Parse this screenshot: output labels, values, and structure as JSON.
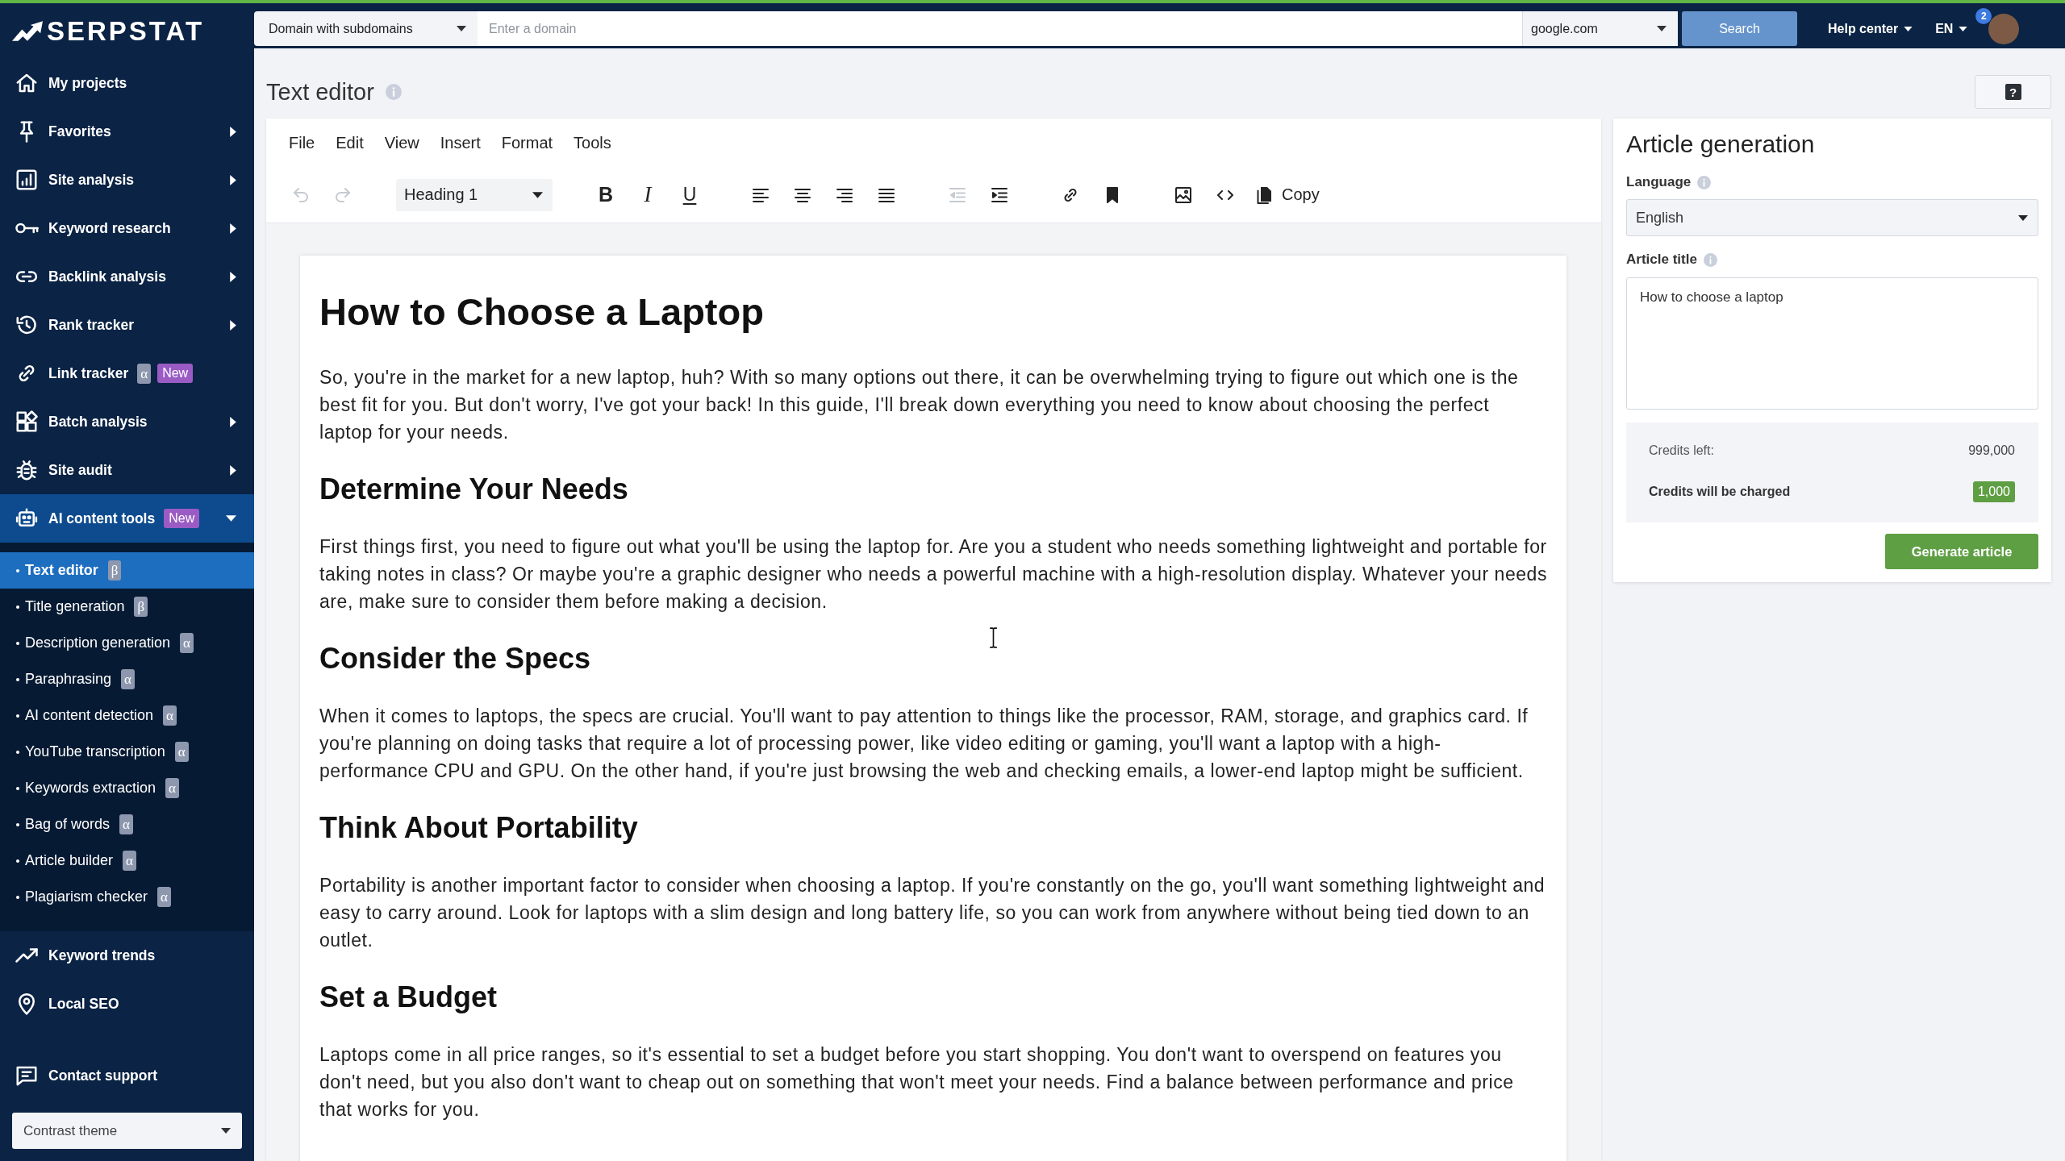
{
  "logo": {
    "text": "SERPSTAT"
  },
  "sidebar": {
    "items": [
      {
        "label": "My projects",
        "kind": "link",
        "selected": false
      },
      {
        "label": "Favorites",
        "kind": "group",
        "expanded": false,
        "selected": false
      },
      {
        "label": "Site analysis",
        "kind": "group",
        "expanded": false,
        "selected": false
      },
      {
        "label": "Keyword research",
        "kind": "group",
        "expanded": false,
        "selected": false
      },
      {
        "label": "Backlink analysis",
        "kind": "group",
        "expanded": false,
        "selected": false
      },
      {
        "label": "Rank tracker",
        "kind": "group",
        "expanded": false,
        "selected": false
      },
      {
        "label": "Link tracker",
        "kind": "link",
        "selected": false,
        "badges": [
          {
            "kind": "stage",
            "text": "α"
          },
          {
            "kind": "new",
            "text": "New"
          }
        ]
      },
      {
        "label": "Batch analysis",
        "kind": "group",
        "expanded": false,
        "selected": false
      },
      {
        "label": "Site audit",
        "kind": "group",
        "expanded": false,
        "selected": false
      },
      {
        "label": "AI content tools",
        "kind": "group",
        "expanded": true,
        "selected": true,
        "badges": [
          {
            "kind": "new",
            "text": "New"
          }
        ],
        "children": [
          {
            "label": "Text editor",
            "selected": true,
            "badges": [
              {
                "kind": "stage",
                "text": "β"
              }
            ]
          },
          {
            "label": "Title generation",
            "selected": false,
            "badges": [
              {
                "kind": "stage",
                "text": "β"
              }
            ]
          },
          {
            "label": "Description generation",
            "selected": false,
            "badges": [
              {
                "kind": "stage",
                "text": "α"
              }
            ]
          },
          {
            "label": "Paraphrasing",
            "selected": false,
            "badges": [
              {
                "kind": "stage",
                "text": "α"
              }
            ]
          },
          {
            "label": "AI content detection",
            "selected": false,
            "badges": [
              {
                "kind": "stage",
                "text": "α"
              }
            ]
          },
          {
            "label": "YouTube transcription",
            "selected": false,
            "badges": [
              {
                "kind": "stage",
                "text": "α"
              }
            ]
          },
          {
            "label": "Keywords extraction",
            "selected": false,
            "badges": [
              {
                "kind": "stage",
                "text": "α"
              }
            ]
          },
          {
            "label": "Bag of words",
            "selected": false,
            "badges": [
              {
                "kind": "stage",
                "text": "α"
              }
            ]
          },
          {
            "label": "Article builder",
            "selected": false,
            "badges": [
              {
                "kind": "stage",
                "text": "α"
              }
            ]
          },
          {
            "label": "Plagiarism checker",
            "selected": false,
            "badges": [
              {
                "kind": "stage",
                "text": "α"
              }
            ]
          }
        ]
      },
      {
        "label": "Keyword trends",
        "kind": "link",
        "selected": false
      },
      {
        "label": "Local SEO",
        "kind": "link",
        "selected": false
      }
    ],
    "contact_support": "Contact support",
    "theme_select": "Contrast theme"
  },
  "top_bar": {
    "search_mode": "Domain with subdomains",
    "domain_field": {
      "placeholder": "Enter a domain"
    },
    "database": "google.com",
    "search_button": {
      "label": "Search",
      "disabled": true
    },
    "help_center": "Help center",
    "language": "EN",
    "notifications": "2"
  },
  "page": {
    "title": "Text editor",
    "help_button": "?"
  },
  "editor": {
    "menu": [
      "File",
      "Edit",
      "View",
      "Insert",
      "Format",
      "Tools"
    ],
    "toolbar": [
      [
        {
          "kind": "undo",
          "disabled": true
        },
        {
          "kind": "redo",
          "disabled": true
        }
      ],
      [
        {
          "kind": "blockformat",
          "value": "Heading 1",
          "disabled": false
        }
      ],
      [
        {
          "kind": "bold",
          "label": "B",
          "disabled": false
        },
        {
          "kind": "italic",
          "label": "I",
          "disabled": false
        },
        {
          "kind": "underline",
          "label": "U",
          "disabled": false
        }
      ],
      [
        {
          "kind": "alignleft",
          "disabled": false
        },
        {
          "kind": "aligncenter",
          "disabled": false
        },
        {
          "kind": "alignright",
          "disabled": false
        },
        {
          "kind": "justify",
          "disabled": false
        }
      ],
      [
        {
          "kind": "outdent",
          "disabled": true
        },
        {
          "kind": "indent",
          "disabled": false
        }
      ],
      [
        {
          "kind": "link",
          "disabled": false
        },
        {
          "kind": "bookmark",
          "disabled": false
        }
      ],
      [
        {
          "kind": "image",
          "disabled": false
        },
        {
          "kind": "code",
          "disabled": false
        },
        {
          "kind": "copy",
          "label": "Copy",
          "disabled": false
        }
      ]
    ],
    "document": [
      {
        "kind": "heading1",
        "text": "How to Choose a Laptop"
      },
      {
        "kind": "paragraph",
        "text": "So, you're in the market for a new laptop, huh? With so many options out there, it can be overwhelming trying to figure out which one is the best fit for you. But don't worry, I've got your back! In this guide, I'll break down everything you need to know about choosing the perfect laptop for your needs."
      },
      {
        "kind": "heading2",
        "text": "Determine Your Needs"
      },
      {
        "kind": "paragraph",
        "text": "First things first, you need to figure out what you'll be using the laptop for. Are you a student who needs something lightweight and portable for taking notes in class? Or maybe you're a graphic designer who needs a powerful machine with a high-resolution display. Whatever your needs are, make sure to consider them before making a decision."
      },
      {
        "kind": "heading2",
        "text": "Consider the Specs"
      },
      {
        "kind": "paragraph",
        "text": "When it comes to laptops, the specs are crucial. You'll want to pay attention to things like the processor, RAM, storage, and graphics card. If you're planning on doing tasks that require a lot of processing power, like video editing or gaming, you'll want a laptop with a high-performance CPU and GPU. On the other hand, if you're just browsing the web and checking emails, a lower-end laptop might be sufficient."
      },
      {
        "kind": "heading2",
        "text": "Think About Portability"
      },
      {
        "kind": "paragraph",
        "text": "Portability is another important factor to consider when choosing a laptop. If you're constantly on the go, you'll want something lightweight and easy to carry around. Look for laptops with a slim design and long battery life, so you can work from anywhere without being tied down to an outlet."
      },
      {
        "kind": "heading2",
        "text": "Set a Budget"
      },
      {
        "kind": "paragraph",
        "text": "Laptops come in all price ranges, so it's essential to set a budget before you start shopping. You don't want to overspend on features you don't need, but you also don't want to cheap out on something that won't meet your needs. Find a balance between performance and price that works for you."
      }
    ]
  },
  "article_panel": {
    "title": "Article generation",
    "language": {
      "label": "Language",
      "value": "English"
    },
    "article_title": {
      "label": "Article title",
      "value": "How to choose a laptop"
    },
    "credits": [
      {
        "kind": "balance",
        "label": "Credits left:",
        "value": "999,000"
      },
      {
        "kind": "charge",
        "label": "Credits will be charged",
        "value": "1,000"
      }
    ],
    "button": "Generate article"
  }
}
